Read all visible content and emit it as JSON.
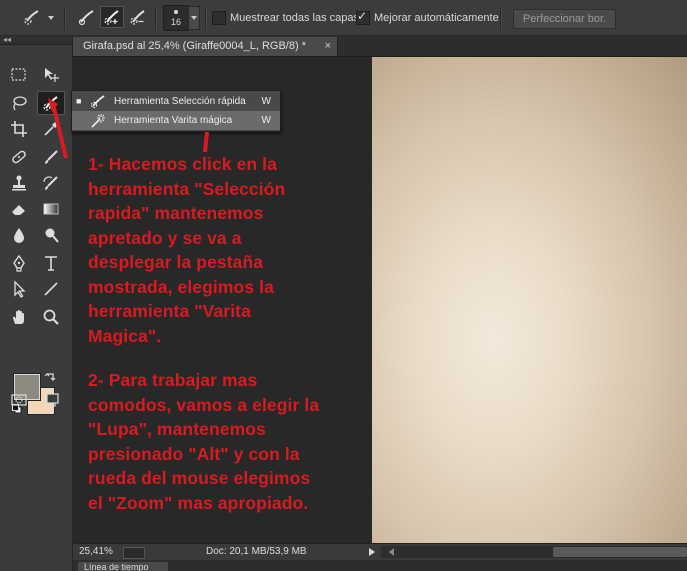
{
  "options_bar": {
    "brush_size": "16",
    "sample_all_layers_label": "Muestrear todas las capas",
    "sample_all_layers_checked": false,
    "auto_enhance_label": "Mejorar automáticamente",
    "auto_enhance_checked": true,
    "refine_edge_label": "Perfeccionar bor."
  },
  "document": {
    "tab_title": "Girafa.psd al 25,4% (Giraffe0004_L, RGB/8) *",
    "close_glyph": "×"
  },
  "tools": {
    "collapse_glyph": "◂◂",
    "foreground_color": "#8c8a7e",
    "background_color": "#f7d6b4"
  },
  "flyout": {
    "items": [
      {
        "label": "Herramienta Selección rápida",
        "shortcut": "W",
        "current_marker": "■",
        "icon": "quick-selection-icon"
      },
      {
        "label": "Herramienta Varita mágica",
        "shortcut": "W",
        "current_marker": "",
        "icon": "magic-wand-icon"
      }
    ]
  },
  "annotations": {
    "step1": "1- Hacemos click en la\nherramienta \"Selección\nrapida\" mantenemos\napretado y se va a\ndesplegar la pestaña\nmostrada, elegimos la\nherramienta \"Varita\nMagica\".",
    "step2": "2- Para trabajar mas\ncomodos, vamos a elegir la\n\"Lupa\", mantenemos\npresionado \"Alt\" y con la\nrueda del mouse elegimos\nel \"Zoom\" mas apropiado.",
    "color": "#d81a22"
  },
  "status": {
    "zoom": "25,41%",
    "doc_info": "Doc: 20,1 MB/53,9 MB"
  },
  "bottom_panel": {
    "tab_label": "Línea de tiempo"
  }
}
